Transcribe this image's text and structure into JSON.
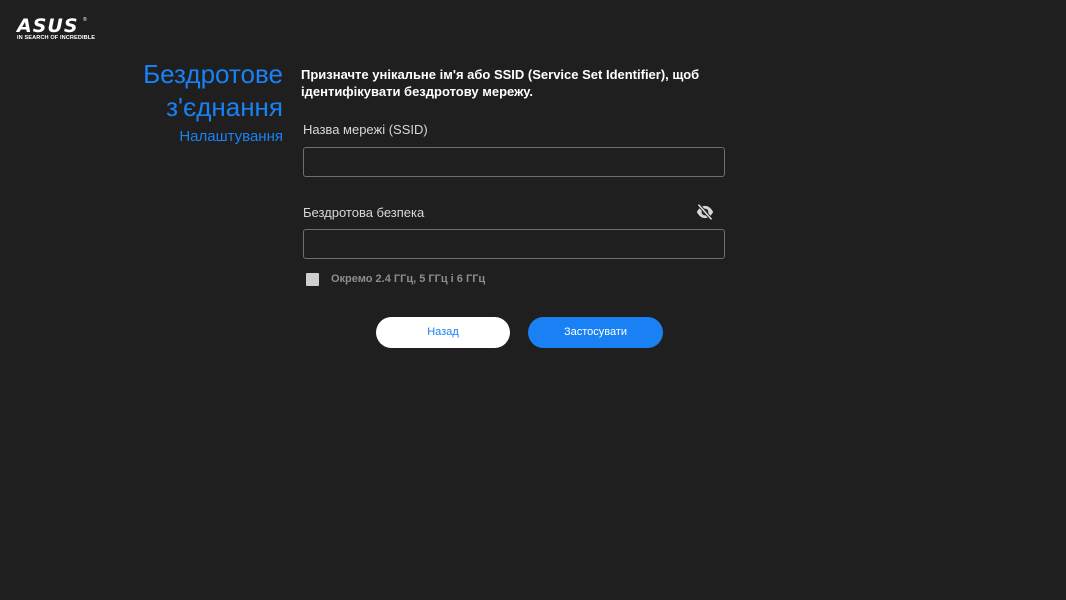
{
  "brand": {
    "logo_text": "ASUS",
    "tagline": "IN SEARCH OF INCREDIBLE",
    "trademark": "®"
  },
  "header": {
    "title_line1": "Бездротове",
    "title_line2": "з'єднання",
    "subtitle": "Налаштування"
  },
  "main": {
    "description": "Призначте унікальне ім'я або SSID (Service Set Identifier), щоб ідентифікувати бездротову мережу.",
    "ssid_label": "Назва мережі (SSID)",
    "ssid_value": "",
    "security_label": "Бездротова безпека",
    "security_value": "",
    "separate_bands_label": "Окремо 2.4 ГГц, 5 ГГц і 6 ГГц",
    "separate_bands_checked": false
  },
  "buttons": {
    "back_label": "Назад",
    "apply_label": "Застосувати"
  },
  "colors": {
    "accent": "#1a81f4",
    "background": "#1f1f20"
  },
  "icons": {
    "password_visibility": "eye-slash-icon"
  }
}
